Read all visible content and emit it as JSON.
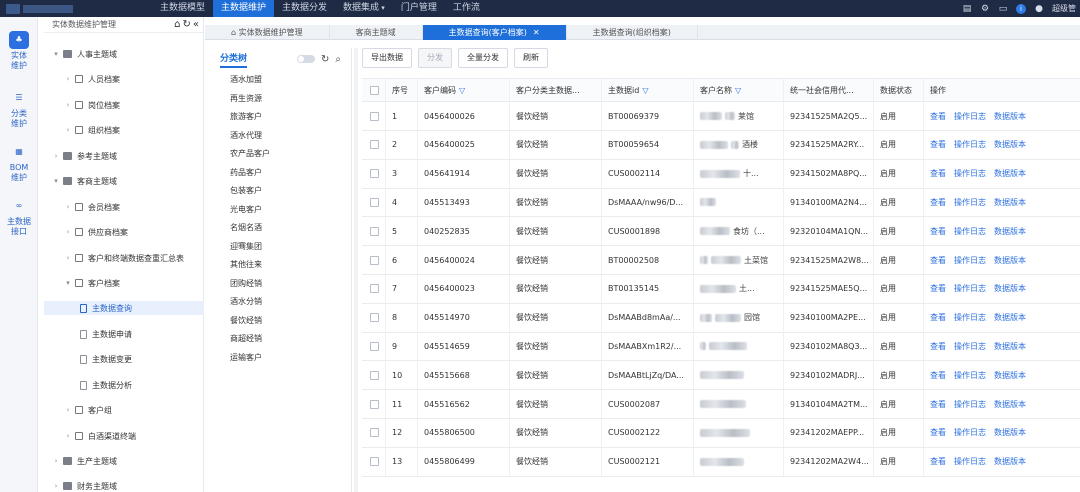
{
  "topnav": {
    "items": [
      "主数据模型",
      "主数据维护",
      "主数据分发",
      "数据集成",
      "门户管理",
      "工作流"
    ],
    "user": "超级管"
  },
  "rail": [
    {
      "label1": "实体",
      "label2": "维护"
    },
    {
      "label1": "分类",
      "label2": "维护"
    },
    {
      "label1": "BOM",
      "label2": "维护"
    },
    {
      "label1": "主数据",
      "label2": "接口"
    }
  ],
  "tree": {
    "header": "实体数据维护管理",
    "nodes": [
      "人事主题域",
      "人员档案",
      "岗位档案",
      "组织档案",
      "参考主题域",
      "客商主题域",
      "会员档案",
      "供应商档案",
      "客户和终端数据查重汇总表",
      "客户档案",
      "主数据查询",
      "主数据申请",
      "主数据变更",
      "主数据分析",
      "客户组",
      "白酒渠道终端",
      "生产主题域",
      "财务主题域"
    ]
  },
  "tabs": [
    "实体数据维护管理",
    "客商主题域",
    "主数据查询(客户档案)",
    "主数据查询(组织档案)"
  ],
  "category": {
    "title": "分类树",
    "items": [
      "酒水加盟",
      "再生资源",
      "旅游客户",
      "酒水代理",
      "农产品客户",
      "药品客户",
      "包装客户",
      "光电客户",
      "名烟名酒",
      "迎骞集团",
      "其他往来",
      "团购经销",
      "酒水分销",
      "餐饮经销",
      "商超经销",
      "运输客户"
    ]
  },
  "toolbar": {
    "export": "导出数据",
    "distribute": "分发",
    "full_distribute": "全量分发",
    "refresh": "刷新"
  },
  "table": {
    "headers": {
      "no": "序号",
      "code": "客户编码",
      "cls": "客户分类主数据...",
      "id": "主数据id",
      "name": "客户名称",
      "uscc": "统一社会信用代...",
      "status": "数据状态",
      "op": "操作"
    },
    "op_links": [
      "查看",
      "操作日志",
      "数据版本"
    ],
    "rows": [
      {
        "no": "1",
        "code": "0456400026",
        "cls": "餐饮经销",
        "id": "BT00069379",
        "name_tail": "莱馆",
        "uscc": "92341525MA2Q5...",
        "status": "启用"
      },
      {
        "no": "2",
        "code": "0456400025",
        "cls": "餐饮经销",
        "id": "BT00059654",
        "name_tail": "酒楼",
        "uscc": "92341525MA2RY...",
        "status": "启用"
      },
      {
        "no": "3",
        "code": "045641914",
        "cls": "餐饮经销",
        "id": "CUS0002114",
        "name_tail": "十...",
        "uscc": "92341502MA8PQ...",
        "status": "启用"
      },
      {
        "no": "4",
        "code": "045513493",
        "cls": "餐饮经销",
        "id": "DsMAAA/nw96/D...",
        "name_tail": "",
        "uscc": "91340100MA2N4...",
        "status": "启用"
      },
      {
        "no": "5",
        "code": "040252835",
        "cls": "餐饮经销",
        "id": "CUS0001898",
        "name_tail": "食坊（...",
        "uscc": "92320104MA1QN...",
        "status": "启用"
      },
      {
        "no": "6",
        "code": "0456400024",
        "cls": "餐饮经销",
        "id": "BT00002508",
        "name_tail": "土菜馆",
        "uscc": "92341525MA2W8...",
        "status": "启用"
      },
      {
        "no": "7",
        "code": "0456400023",
        "cls": "餐饮经销",
        "id": "BT00135145",
        "name_tail": "土...",
        "uscc": "92341525MAE5Q...",
        "status": "启用"
      },
      {
        "no": "8",
        "code": "045514970",
        "cls": "餐饮经销",
        "id": "DsMAABd8mAa/...",
        "name_tail": "园馆",
        "uscc": "92340100MA2PE...",
        "status": "启用"
      },
      {
        "no": "9",
        "code": "045514659",
        "cls": "餐饮经销",
        "id": "DsMAABXm1R2/...",
        "name_tail": "",
        "uscc": "92340102MA8Q3...",
        "status": "启用"
      },
      {
        "no": "10",
        "code": "045515668",
        "cls": "餐饮经销",
        "id": "DsMAABtLjZq/DA...",
        "name_tail": "",
        "uscc": "92340102MADRJ...",
        "status": "启用"
      },
      {
        "no": "11",
        "code": "045516562",
        "cls": "餐饮经销",
        "id": "CUS0002087",
        "name_tail": "",
        "uscc": "91340104MA2TM...",
        "status": "启用"
      },
      {
        "no": "12",
        "code": "0455806500",
        "cls": "餐饮经销",
        "id": "CUS0002122",
        "name_tail": "",
        "uscc": "92341202MAEPP...",
        "status": "启用"
      },
      {
        "no": "13",
        "code": "0455806499",
        "cls": "餐饮经销",
        "id": "CUS0002121",
        "name_tail": "",
        "uscc": "92341202MA2W4...",
        "status": "启用"
      }
    ]
  }
}
